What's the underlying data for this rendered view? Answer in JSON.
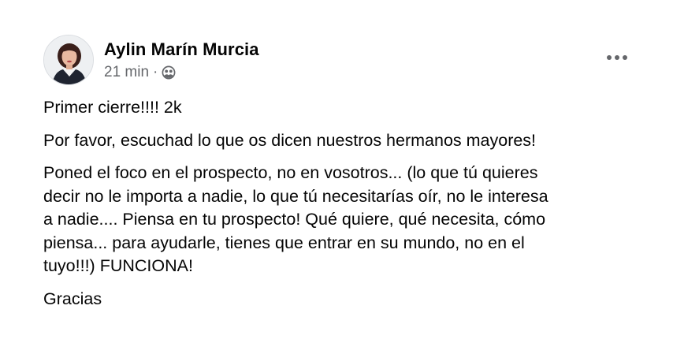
{
  "post": {
    "author": "Aylin Marín Murcia",
    "time": "21 min",
    "separator": "·",
    "audience_icon": "friends-audience-icon",
    "more_icon": "more-options-icon",
    "paragraphs": [
      "Primer cierre!!!! 2k",
      "Por favor, escuchad lo que os dicen nuestros hermanos mayores!",
      "Poned el foco en el prospecto, no en vosotros... (lo que tú quieres\ndecir no le importa a nadie, lo que tú necesitarías oír, no le interesa\na nadie.... Piensa en tu prospecto! Qué quiere, qué necesita, cómo\npiensa... para ayudarle, tienes que entrar en su mundo, no en el\ntuyo!!!) FUNCIONA!",
      "Gracias"
    ]
  },
  "colors": {
    "text_primary": "#050505",
    "text_secondary": "#65676b",
    "background": "#ffffff"
  }
}
